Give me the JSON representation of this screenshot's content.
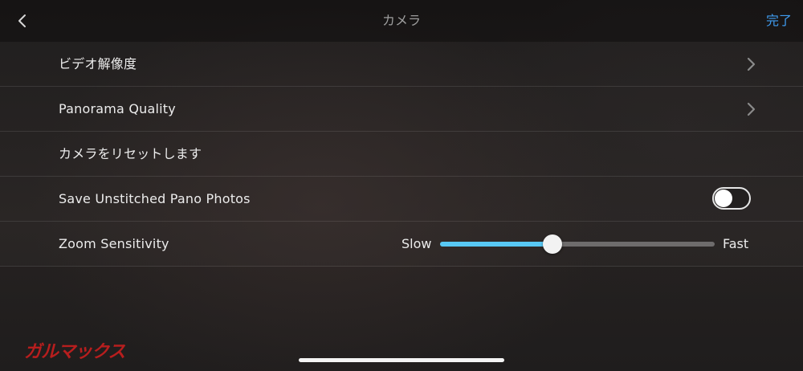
{
  "nav": {
    "title": "カメラ",
    "done_label": "完了",
    "back_icon": "chevron-left-icon"
  },
  "settings": [
    {
      "label": "ビデオ解像度",
      "accessory": "chevron-right-icon"
    },
    {
      "label": "Panorama Quality",
      "accessory": "chevron-right-icon"
    },
    {
      "label": "カメラをリセットします"
    },
    {
      "label": "Save Unstitched Pano Photos",
      "toggle_on": false
    },
    {
      "label": "Zoom Sensitivity",
      "slider": {
        "min_label": "Slow",
        "max_label": "Fast",
        "value_fraction": 0.41
      }
    }
  ],
  "watermark": "ガルマックス",
  "colors": {
    "accent": "#3f9cf0",
    "slider_fill": "#58c8f4",
    "watermark": "#c81e1e"
  }
}
